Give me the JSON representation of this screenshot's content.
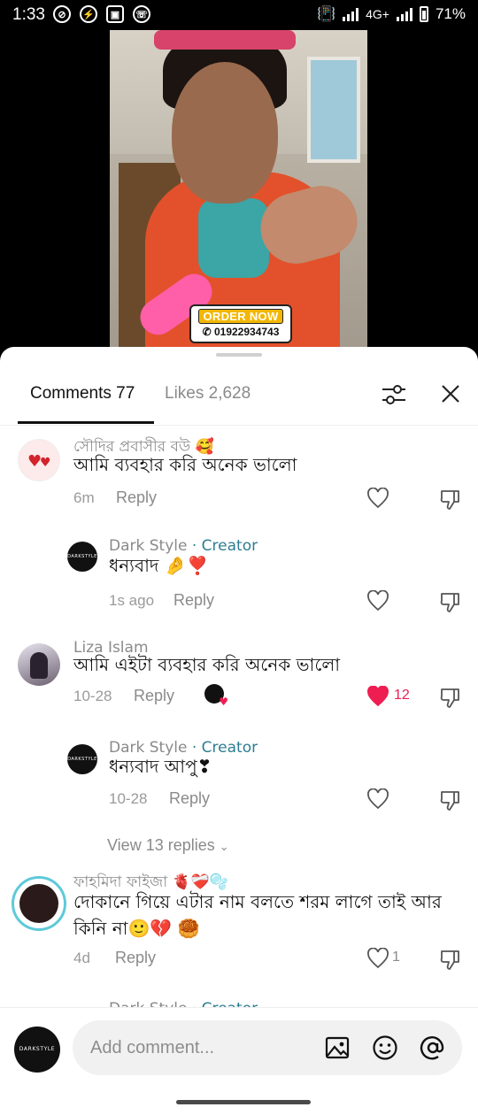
{
  "status_bar": {
    "time": "1:33",
    "network": "4G+",
    "battery": "71%"
  },
  "video": {
    "badge_title": "ORDER NOW",
    "badge_phone": "01922934743"
  },
  "tabs": {
    "comments": "Comments 77",
    "likes": "Likes 2,628"
  },
  "comments": [
    {
      "author": "সৌদির প্রবাসীর বউ 🥰",
      "text": "আমি ব্যবহার করি অনেক ভালো",
      "time": "6m",
      "reply": "Reply"
    },
    {
      "author": "Dark Style",
      "creator": " · Creator",
      "text": "ধন্যবাদ 🤌❣️",
      "time": "1s ago",
      "reply": "Reply"
    },
    {
      "author": "Liza Islam",
      "text": "আমি এইটা ব্যবহার করি অনেক ভালো",
      "time": "10-28",
      "reply": "Reply",
      "likes": "12"
    },
    {
      "author": "Dark Style",
      "creator": " · Creator",
      "text": "ধন্যবাদ আপু❣",
      "time": "10-28",
      "reply": "Reply"
    },
    {
      "author": "ফাহমিদা ফাইজা 🫀❤️‍🩹🫧",
      "text": "দোকানে গিয়ে এটার নাম বলতে শরম লাগে তাই আর কিনি না🙂💔 🥮",
      "time": "4d",
      "reply": "Reply",
      "likes": "1"
    }
  ],
  "view_replies": "View 13 replies",
  "partial_next": {
    "author": "Dark Style",
    "creator": " · Creator"
  },
  "avatar_text": "DARKSTYLE",
  "input": {
    "placeholder": "Add comment..."
  },
  "colors": {
    "accent": "#2d7d92",
    "liked": "#ee1d52",
    "text_muted": "#8a8a8a"
  }
}
